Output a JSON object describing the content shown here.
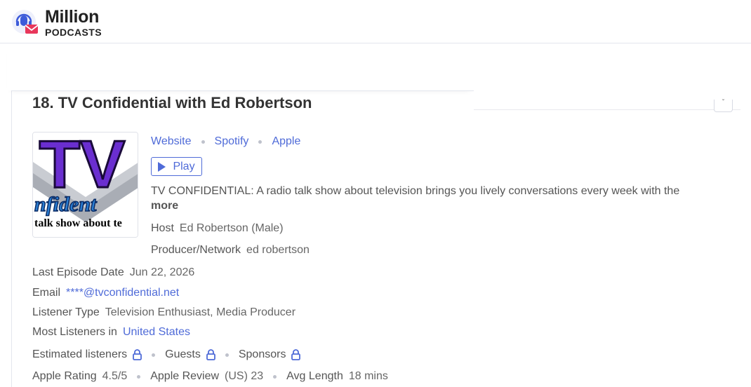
{
  "brand": {
    "line1": "Million",
    "line2": "PODCASTS"
  },
  "podcast": {
    "title": "18. TV Confidential with Ed Robertson",
    "links": [
      "Website",
      "Spotify",
      "Apple"
    ],
    "play_label": "Play",
    "description": "TV CONFIDENTIAL: A radio talk show about television brings you lively conversations every week with the",
    "more_label": "more",
    "artwork_text": {
      "big": "TV",
      "script": "nfident",
      "tagline": "talk show about te"
    }
  },
  "details": {
    "host_label": "Host",
    "host_value": "Ed Robertson (Male)",
    "producer_label": "Producer/Network",
    "producer_value": "ed robertson",
    "last_episode_label": "Last Episode Date",
    "last_episode_value": "Jun 22, 2026",
    "email_label": "Email",
    "email_value": "****@tvconfidential.net",
    "listener_type_label": "Listener Type",
    "listener_type_value": "Television Enthusiast, Media Producer",
    "most_listeners_label": "Most Listeners in",
    "most_listeners_value": "United States",
    "estimated_label": "Estimated listeners",
    "guests_label": "Guests",
    "sponsors_label": "Sponsors",
    "rating_label": "Apple Rating",
    "rating_value": "4.5/5",
    "review_label": "Apple Review",
    "review_value": "(US) 23",
    "avg_length_label": "Avg Length",
    "avg_length_value": "18 mins"
  },
  "icons": {
    "lock": "lock-icon",
    "play": "play-icon",
    "logo": "microphone-envelope-icon"
  },
  "colors": {
    "accent": "#4f6bd8",
    "logo_pink": "#e8375b",
    "logo_blue": "#3d5bd9"
  }
}
